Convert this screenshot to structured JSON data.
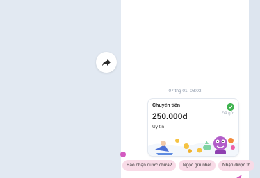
{
  "chat": {
    "timestamp": "07 thg 01, 08:03"
  },
  "share_button": {
    "icon": "share-forward-icon"
  },
  "transfer_card": {
    "title": "Chuyển tiền",
    "amount": "250.000đ",
    "status": "Đã gửi",
    "note": "Uy tín",
    "status_icon": "check-circle-icon",
    "colors": {
      "check": "#3fb34f"
    }
  },
  "quick_replies": [
    {
      "label": "Bảo nhận được chưa?"
    },
    {
      "label": "Ngọc gửi nhé!"
    },
    {
      "label": "Nhận được th"
    }
  ],
  "colors": {
    "background": "#e2e9f2",
    "chip": "#f8dbe7",
    "reaction": "#d35ac0"
  }
}
